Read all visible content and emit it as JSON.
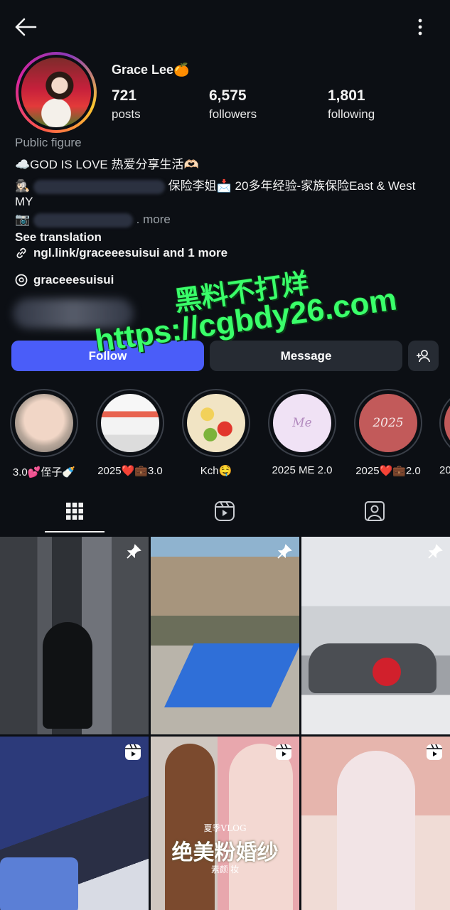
{
  "profile": {
    "name": "Grace Lee🍊",
    "stats": [
      {
        "value": "721",
        "label": "posts"
      },
      {
        "value": "6,575",
        "label": "followers"
      },
      {
        "value": "1,801",
        "label": "following"
      }
    ],
    "category": "Public figure",
    "bio_line1": "☁️GOD IS LOVE 热爱分享生活🫶🏻",
    "bio_line2_prefix": "🕵🏻‍♀️",
    "bio_line2_rest": "保险李姐📩 20多年经验-家族保险East & West",
    "bio_line3": "MY",
    "bio_line4_prefix": "📷",
    "bio_line4_more": ". more",
    "see_translation": "See translation",
    "link_text": "ngl.link/graceeesuisui and 1 more",
    "threads_handle": "graceeesuisui"
  },
  "actions": {
    "follow": "Follow",
    "message": "Message"
  },
  "highlights": [
    {
      "label": "3.0💕侄子🍼"
    },
    {
      "label": "2025❤️💼3.0"
    },
    {
      "label": "Kch🤤"
    },
    {
      "label": "2025 ME 2.0",
      "cover_text": "Me"
    },
    {
      "label": "2025❤️💼2.0",
      "cover_text": "2025"
    },
    {
      "label": "20"
    }
  ],
  "posts": [
    {
      "type": "pinned"
    },
    {
      "type": "pinned"
    },
    {
      "type": "pinned"
    },
    {
      "type": "reel"
    },
    {
      "type": "reel",
      "overlay_small": "夏季VLOG",
      "overlay_title": "绝美粉婚纱",
      "overlay_sub": "素颜 妆"
    },
    {
      "type": "reel"
    }
  ],
  "watermark": {
    "line1": "黑料不打烊",
    "line2": "https://cgbdy26.com"
  },
  "colors": {
    "background": "#0c0f14",
    "follow_button": "#4a5df9",
    "secondary_button": "#262b33",
    "watermark": "#3aff6a"
  }
}
